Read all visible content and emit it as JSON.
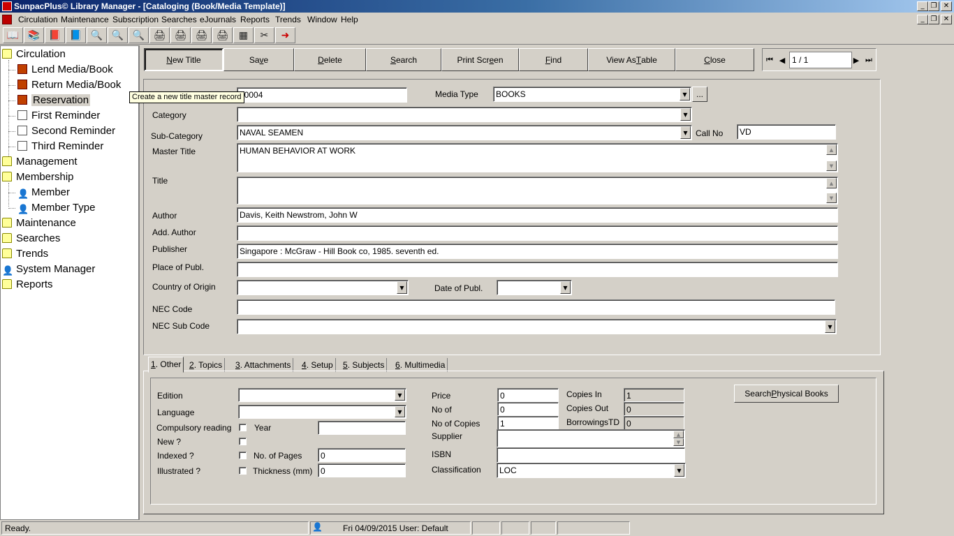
{
  "window": {
    "title": "SunpacPlus© Library Manager - [Cataloging (Book/Media Template)]",
    "minimize": "_",
    "restore": "❐",
    "close": "✕"
  },
  "menu": [
    "Circulation",
    "Maintenance",
    "Subscription",
    "Searches",
    "eJournals",
    "Reports",
    "Trends",
    "Window",
    "Help"
  ],
  "toolbar_icons": [
    "lend-icon",
    "return-icon",
    "reservation-icon",
    "catalog-icon",
    "search-icon",
    "search-icon",
    "search-icon",
    "printer-icon",
    "printer-icon",
    "printer-icon",
    "printer-icon",
    "calculator-icon",
    "tools-icon",
    "exit-icon"
  ],
  "sidebar": {
    "items": [
      {
        "label": "Circulation",
        "icon": "folder-icon"
      },
      {
        "label": "Lend Media/Book",
        "icon": "book-icon"
      },
      {
        "label": "Return Media/Book",
        "icon": "book-icon"
      },
      {
        "label": "Reservation",
        "icon": "book-icon"
      },
      {
        "label": "First Reminder",
        "icon": "page-icon"
      },
      {
        "label": "Second Reminder",
        "icon": "page-icon"
      },
      {
        "label": "Third Reminder",
        "icon": "page-icon"
      },
      {
        "label": "Management",
        "icon": "folder-icon"
      },
      {
        "label": "Membership",
        "icon": "folder-icon"
      },
      {
        "label": "Member",
        "icon": "person-icon"
      },
      {
        "label": "Member Type",
        "icon": "person-icon"
      },
      {
        "label": "Maintenance",
        "icon": "folder-icon"
      },
      {
        "label": "Searches",
        "icon": "folder-icon"
      },
      {
        "label": "Trends",
        "icon": "folder-icon"
      },
      {
        "label": "System Manager",
        "icon": "person-icon"
      },
      {
        "label": "Reports",
        "icon": "folder-icon"
      }
    ]
  },
  "actions": {
    "new_title": {
      "pre": "",
      "key": "N",
      "post": "ew Title"
    },
    "save": {
      "pre": "Sa",
      "key": "v",
      "post": "e"
    },
    "delete": {
      "pre": "",
      "key": "D",
      "post": "elete"
    },
    "search": {
      "pre": "",
      "key": "S",
      "post": "earch"
    },
    "print_screen": {
      "pre": "Print Scr",
      "key": "e",
      "post": "en"
    },
    "find": {
      "pre": "",
      "key": "F",
      "post": "ind"
    },
    "view_as_table": {
      "pre": "View As ",
      "key": "T",
      "post": "able"
    },
    "close": {
      "pre": "",
      "key": "C",
      "post": "lose"
    }
  },
  "navigator": {
    "first": "⏮",
    "prev": "◀",
    "counter": "1 / 1",
    "next": "▶",
    "last": "⏭"
  },
  "tooltip": "Create a new title master record",
  "form": {
    "record_no": "00004",
    "media_type_label": "Media Type",
    "media_type": "BOOKS",
    "ellipsis": "...",
    "category_label": "Category",
    "category": "",
    "subcategory_label": "Sub-Category",
    "subcategory": "NAVAL SEAMEN",
    "call_no_label": "Call No",
    "call_no": "VD",
    "master_title_label": "Master Title",
    "master_title": "HUMAN BEHAVIOR AT WORK",
    "title_label": "Title",
    "title": "",
    "author_label": "Author",
    "author": "Davis, Keith  Newstrom, John W",
    "add_author_label": "Add. Author",
    "add_author": "",
    "publisher_label": "Publisher",
    "publisher": "Singapore : McGraw - Hill Book co, 1985. seventh ed.",
    "place_label": "Place of Publ.",
    "place": "",
    "country_label": "Country of Origin",
    "country": "",
    "date_label": "Date of Publ.",
    "date": "",
    "nec_code_label": "NEC Code",
    "nec_code": "",
    "nec_sub_label": "NEC Sub Code",
    "nec_sub": ""
  },
  "tabs": [
    {
      "num": "1",
      "label": ". Other"
    },
    {
      "num": "2",
      "label": ". Topics"
    },
    {
      "num": "3",
      "label": ". Attachments"
    },
    {
      "num": "4",
      "label": ". Setup"
    },
    {
      "num": "5",
      "label": ". Subjects"
    },
    {
      "num": "6",
      "label": ". Multimedia"
    }
  ],
  "other": {
    "edition_label": "Edition",
    "edition": "",
    "language_label": "Language",
    "language": "",
    "compulsory_label": "Compulsory reading",
    "year_label": "Year",
    "year": "",
    "new_label": "New ?",
    "indexed_label": "Indexed ?",
    "pages_label": "No. of Pages",
    "pages": "0",
    "illustrated_label": "Illustrated ?",
    "thickness_label": "Thickness (mm)",
    "thickness": "0",
    "price_label": "Price",
    "price": "0",
    "no_of_label": "No of",
    "no_of": "0",
    "copies_label": "No of Copies",
    "copies": "1",
    "copies_in_label": "Copies In",
    "copies_in": "1",
    "copies_out_label": "Copies Out",
    "copies_out": "0",
    "borrowings_label": "BorrowingsTD",
    "borrowings": "0",
    "supplier_label": "Supplier",
    "supplier": "",
    "isbn_label": "ISBN",
    "isbn": "",
    "classification_label": "Classification",
    "classification": "LOC",
    "search_physical": {
      "pre": "Search ",
      "key": "P",
      "post": "hysical Books"
    }
  },
  "status": {
    "ready": "Ready.",
    "datetime_user": "Fri 04/09/2015 User: Default"
  }
}
